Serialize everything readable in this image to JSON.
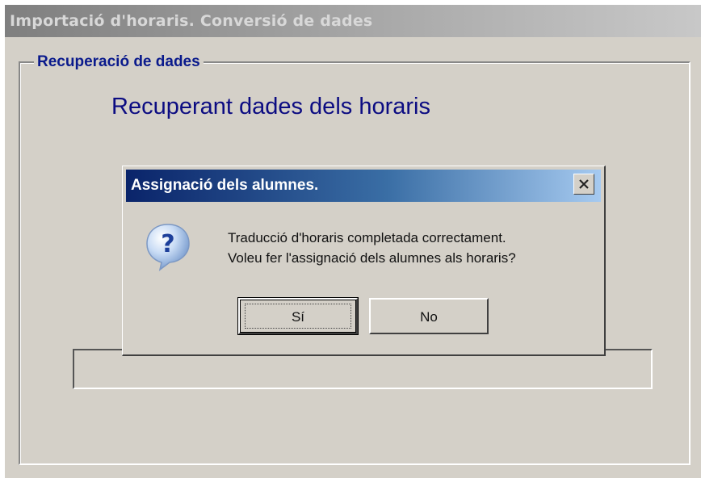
{
  "window": {
    "title": "Importació d'horaris. Conversió de dades",
    "group_label": "Recuperació de dades",
    "status_text": "Recuperant dades dels horaris"
  },
  "dialog": {
    "title": "Assignació dels alumnes.",
    "close_icon": "close-icon",
    "icon": "question-icon",
    "message_line1": "Traducció d'horaris completada correctament.",
    "message_line2": "Voleu  fer l'assignació dels alumnes als horaris?",
    "yes_label": "Sí",
    "no_label": "No"
  },
  "colors": {
    "dialog_title_start": "#0a246a",
    "dialog_title_end": "#a6caf0",
    "face": "#d4d0c8",
    "heading_text": "#0c0c82"
  }
}
